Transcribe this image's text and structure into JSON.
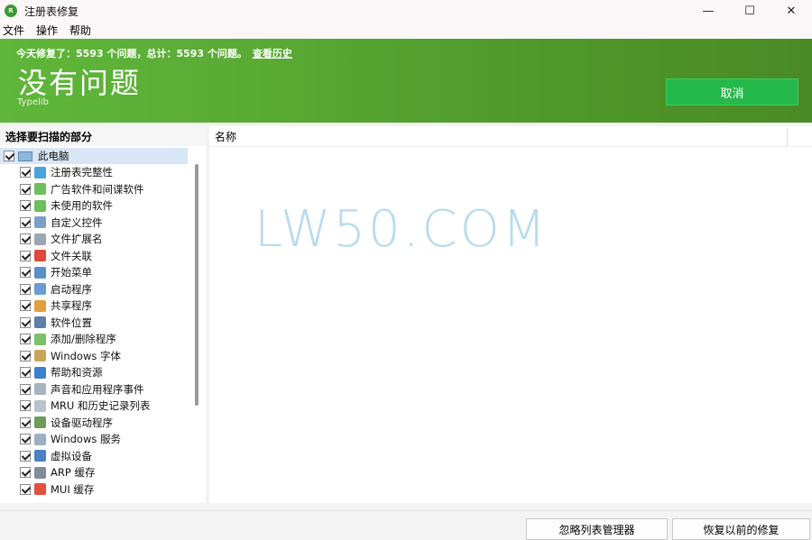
{
  "window": {
    "title": "注册表修复",
    "app_icon": "app-logo-icon"
  },
  "menu": [
    "文件",
    "操作",
    "帮助"
  ],
  "banner": {
    "status_line": "今天修复了：5593 个问题，总计：5593 个问题。",
    "history_link": "查看历史",
    "headline": "没有问题",
    "subtext": "Typelib",
    "cancel_label": "取消",
    "colors": {
      "banner_green": "#56a832",
      "cancel_green": "#25b84a"
    }
  },
  "left_panel": {
    "header": "选择要扫描的部分",
    "root_label": "此电脑",
    "items": [
      {
        "label": "注册表完整性",
        "icon": "registry-icon",
        "color": "#4aa3df"
      },
      {
        "label": "广告软件和间谍软件",
        "icon": "spyware-icon",
        "color": "#6cbf5a"
      },
      {
        "label": "未使用的软件",
        "icon": "recycle-bin-icon",
        "color": "#6cbf5a"
      },
      {
        "label": "自定义控件",
        "icon": "controls-icon",
        "color": "#7aa0c8"
      },
      {
        "label": "文件扩展名",
        "icon": "file-extension-icon",
        "color": "#9aa6b2"
      },
      {
        "label": "文件关联",
        "icon": "file-association-icon",
        "color": "#e04a3a"
      },
      {
        "label": "开始菜单",
        "icon": "start-menu-icon",
        "color": "#5b8fc9"
      },
      {
        "label": "启动程序",
        "icon": "startup-icon",
        "color": "#6b9bd3"
      },
      {
        "label": "共享程序",
        "icon": "shared-programs-icon",
        "color": "#e0a040"
      },
      {
        "label": "软件位置",
        "icon": "software-location-icon",
        "color": "#5d7fa8"
      },
      {
        "label": "添加/删除程序",
        "icon": "add-remove-icon",
        "color": "#7cc06a"
      },
      {
        "label": "Windows 字体",
        "icon": "font-icon",
        "color": "#c9a55a"
      },
      {
        "label": "帮助和资源",
        "icon": "help-icon",
        "color": "#3f7fd0"
      },
      {
        "label": "声音和应用程序事件",
        "icon": "sound-icon",
        "color": "#a8b4c0"
      },
      {
        "label": "MRU 和历史记录列表",
        "icon": "history-icon",
        "color": "#b8c2cc"
      },
      {
        "label": "设备驱动程序",
        "icon": "driver-icon",
        "color": "#6e9a5a"
      },
      {
        "label": "Windows 服务",
        "icon": "services-icon",
        "color": "#9ab0c4"
      },
      {
        "label": "虚拟设备",
        "icon": "virtual-device-icon",
        "color": "#4d7fc4"
      },
      {
        "label": "ARP 缓存",
        "icon": "arp-cache-icon",
        "color": "#7f8d9a"
      },
      {
        "label": "MUI 缓存",
        "icon": "mui-cache-icon",
        "color": "#e0503c"
      }
    ]
  },
  "right_panel": {
    "column_name": "名称",
    "watermark": "LW50.COM"
  },
  "bottom": {
    "ignore_list_label": "忽略列表管理器",
    "restore_label": "恢复以前的修复"
  }
}
